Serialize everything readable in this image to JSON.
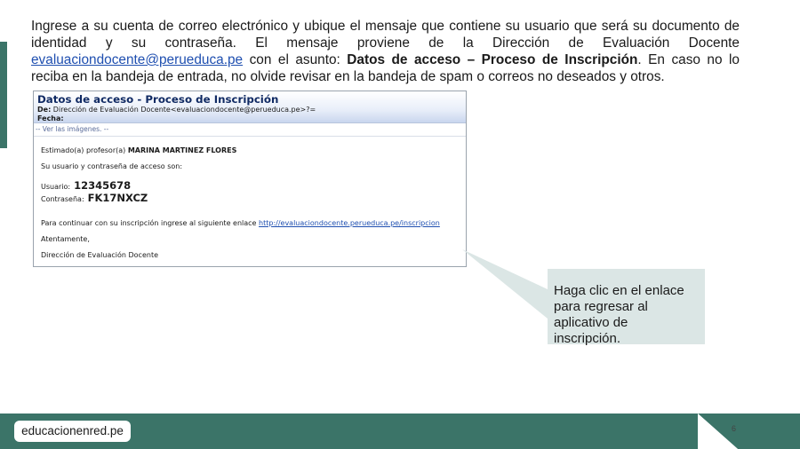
{
  "intro": {
    "text_1": "Ingrese a su cuenta de correo electrónico y ubique el mensaje que contiene su usuario que será su documento de identidad y su contraseña. El mensaje proviene de la Dirección de Evaluación Docente ",
    "email_link": "evaluaciondocente@perueduca.pe",
    "text_2": " con el asunto: ",
    "subject": "Datos de acceso – Proceso de Inscripción",
    "text_3": ". En caso no lo reciba en la bandeja de entrada, no olvide revisar en la bandeja de spam o correos no deseados y otros."
  },
  "email": {
    "title": "Datos de acceso - Proceso de Inscripción",
    "from_label": "De:",
    "from_value": " Dirección de Evaluación Docente<evaluaciondocente@perueduca.pe>?=",
    "date_label": "Fecha:",
    "images_line": "-- Ver las imágenes. --",
    "greeting_prefix": "Estimado(a) profesor(a) ",
    "greeting_name": "MARINA MARTINEZ FLORES",
    "access_intro": "Su usuario y contraseña de acceso son:",
    "user_label": "Usuario:",
    "user_value": "12345678",
    "password_label": "Contraseña:",
    "password_value": "FK17NXCZ",
    "continue_text": "Para continuar con su inscripción ingrese al siguiente enlace ",
    "continue_link": "http://evaluaciondocente.perueduca.pe/inscripcion",
    "regards": "Atentamente,",
    "signature": "Dirección de Evaluación Docente"
  },
  "callout": {
    "text": "Haga clic en el enlace para regresar al aplicativo de inscripción."
  },
  "footer": {
    "logo_text": "educacionenred.pe",
    "page_number": "6"
  },
  "colors": {
    "accent_green": "#3b7468",
    "callout_bg": "#dbe6e5",
    "link_blue": "#1f4fb0",
    "email_title": "#102a63"
  }
}
